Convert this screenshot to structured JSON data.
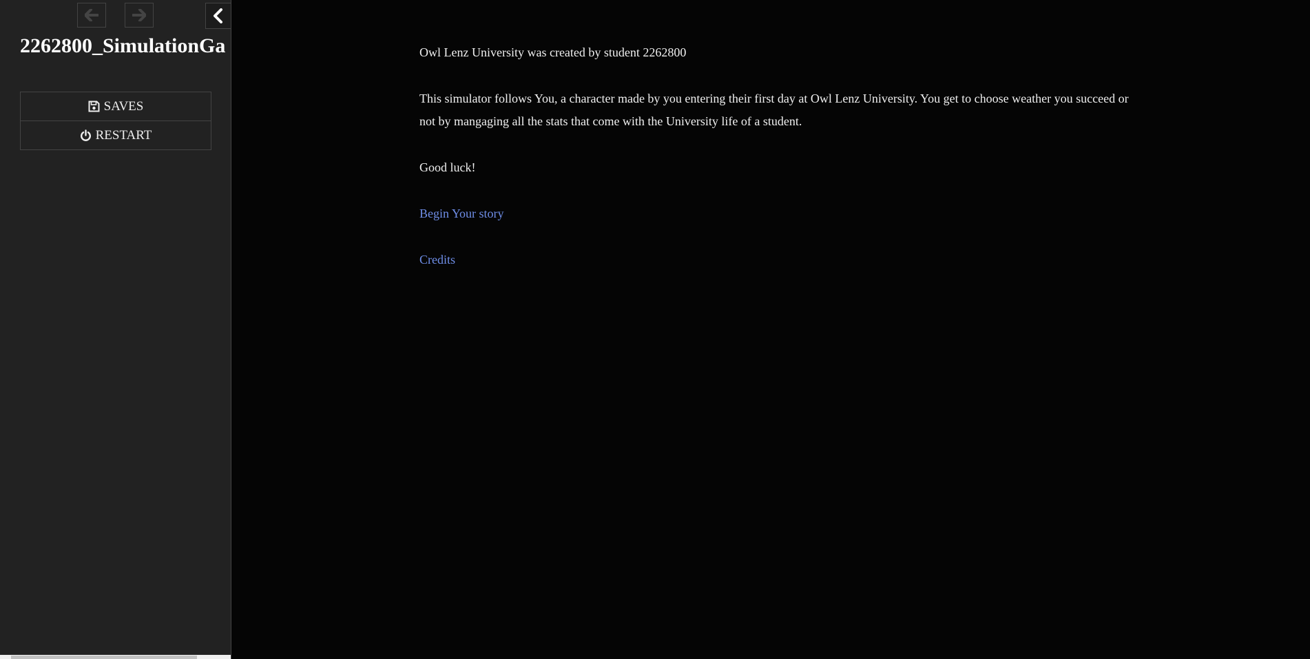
{
  "sidebar": {
    "title": "2262800_SimulationGa",
    "back_icon": "arrow-left-icon",
    "forward_icon": "arrow-right-icon",
    "toggle_icon": "chevron-left-icon",
    "menu": [
      {
        "label": "SAVES",
        "icon": "save-icon"
      },
      {
        "label": "RESTART",
        "icon": "power-icon"
      }
    ]
  },
  "passage": {
    "intro": "Owl Lenz University was created by student 2262800",
    "description": "This simulator follows You, a character made by you entering their first day at Owl Lenz University. You get to choose weather you succeed or not by mangaging all the stats that come with the University life of a student.",
    "closing": "Good luck!",
    "begin_link": "Begin Your story",
    "credits_link": "Credits"
  },
  "colors": {
    "background": "#050505",
    "sidebar": "#222222",
    "link": "#6f8ee8",
    "text": "#f0f0f0"
  }
}
